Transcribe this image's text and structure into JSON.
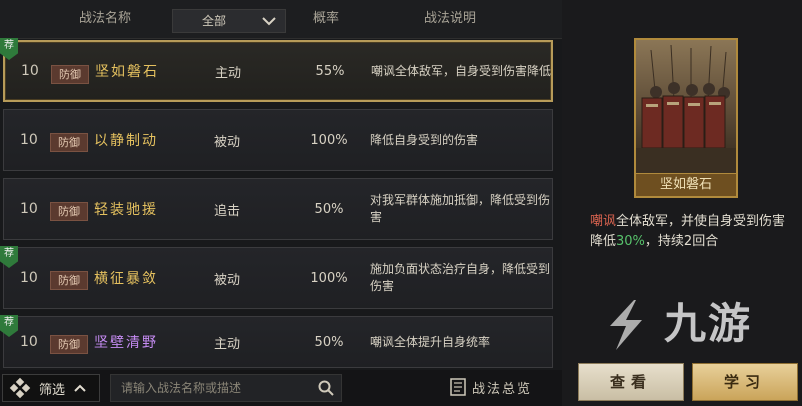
{
  "header": {
    "col_name": "战法名称",
    "filter_selected": "全部",
    "col_rate": "概率",
    "col_desc": "战法说明"
  },
  "rows": [
    {
      "level": "10",
      "tag": "防御",
      "name": "坚如磐石",
      "type": "主动",
      "rate": "55%",
      "desc": "嘲讽全体敌军，自身受到伤害降低",
      "recommended": true,
      "selected": true
    },
    {
      "level": "10",
      "tag": "防御",
      "name": "以静制动",
      "type": "被动",
      "rate": "100%",
      "desc": "降低自身受到的伤害",
      "recommended": false,
      "selected": false
    },
    {
      "level": "10",
      "tag": "防御",
      "name": "轻装驰援",
      "type": "追击",
      "rate": "50%",
      "desc": "对我军群体施加抵御，降低受到伤害",
      "recommended": false,
      "selected": false
    },
    {
      "level": "10",
      "tag": "防御",
      "name": "横征暴敛",
      "type": "被动",
      "rate": "100%",
      "desc": "施加负面状态治疗自身，降低受到伤害",
      "recommended": true,
      "selected": false
    },
    {
      "level": "10",
      "tag": "防御",
      "name": "坚壁清野",
      "type": "主动",
      "rate": "50%",
      "desc": "嘲讽全体提升自身统率",
      "recommended": true,
      "selected": false,
      "name_color": "purple"
    }
  ],
  "recommend_badge": "荐",
  "bottom": {
    "filter_label": "筛选",
    "search_placeholder": "请输入战法名称或描述",
    "overview_label": "战法总览"
  },
  "detail": {
    "card_name": "坚如磐石",
    "desc_part1": "嘲讽",
    "desc_part2": "全体敌军，并使自身受到伤害降低",
    "desc_part3": "30%",
    "desc_part4": "，持续2回合"
  },
  "buttons": {
    "view": "查看",
    "learn": "学习"
  },
  "watermark": "九游",
  "colors": {
    "gold_name": "#e5c15f",
    "purple_name": "#c58bf2",
    "recommend": "#2f7a3b",
    "highlight_red": "#d9634f",
    "highlight_green": "#58c26c"
  }
}
